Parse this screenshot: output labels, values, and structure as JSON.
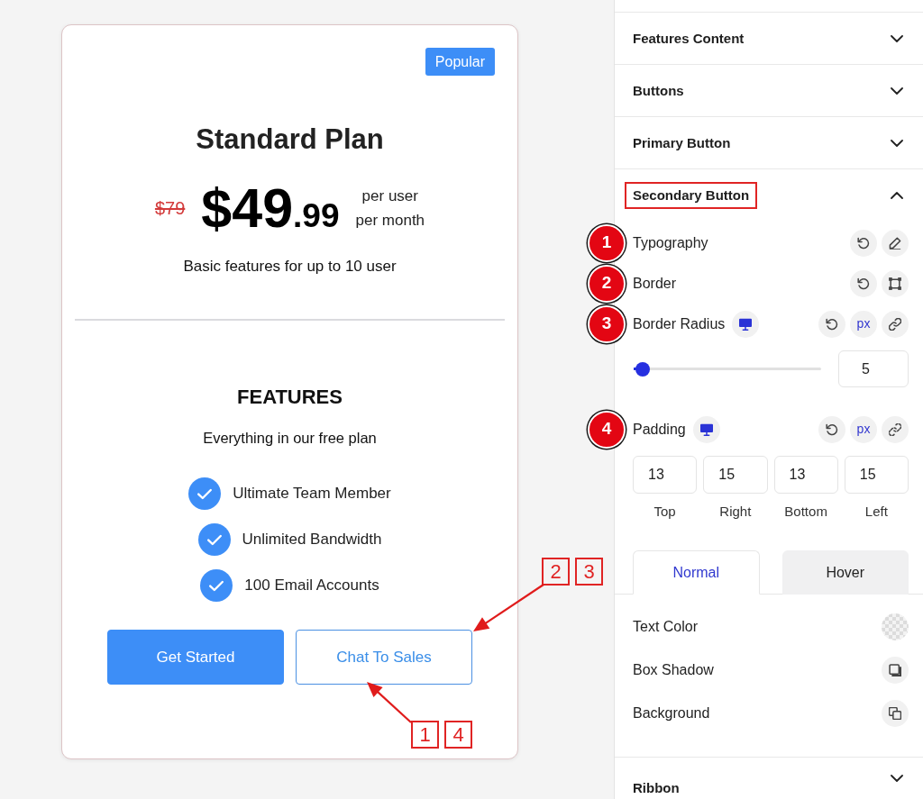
{
  "pricing_card": {
    "badge": "Popular",
    "title": "Standard Plan",
    "old_price": "$79",
    "price": {
      "amount": "$49",
      "cents": ".99"
    },
    "price_period": [
      "per user",
      "per month"
    ],
    "description": "Basic features for up to 10 user",
    "features_heading": "FEATURES",
    "features_subheading": "Everything in our free plan",
    "features": [
      "Ultimate Team Member",
      "Unlimited Bandwidth",
      "100 Email Accounts"
    ],
    "buttons": [
      {
        "label": "Get Started",
        "kind": "primary"
      },
      {
        "label": "Chat To Sales",
        "kind": "secondary"
      }
    ]
  },
  "callouts": [
    {
      "labels": [
        "2",
        "3"
      ]
    },
    {
      "labels": [
        "1",
        "4"
      ]
    }
  ],
  "settings_panel": {
    "sections": [
      {
        "title": "Features Content",
        "expanded": false,
        "highlighted": false
      },
      {
        "title": "Buttons",
        "expanded": false,
        "highlighted": false
      },
      {
        "title": "Primary Button",
        "expanded": false,
        "highlighted": false
      },
      {
        "title": "Secondary Button",
        "expanded": true,
        "highlighted": true,
        "controls": [
          {
            "kind": "typography",
            "marker": "1",
            "label": "Typography"
          },
          {
            "kind": "border",
            "marker": "2",
            "label": "Border"
          },
          {
            "kind": "slider",
            "marker": "3",
            "label": "Border Radius",
            "unit": "px",
            "level": 0.05,
            "value": "5"
          },
          {
            "kind": "dimensions",
            "marker": "4",
            "label": "Padding",
            "unit": "px",
            "fields": [
              {
                "label": "Top",
                "value": "13"
              },
              {
                "label": "Right",
                "value": "15"
              },
              {
                "label": "Bottom",
                "value": "13"
              },
              {
                "label": "Left",
                "value": "15"
              }
            ]
          }
        ],
        "tabs": [
          {
            "label": "Normal",
            "selected": true
          },
          {
            "label": "Hover",
            "selected": false
          }
        ],
        "style_options": [
          {
            "kind": "color",
            "label": "Text Color"
          },
          {
            "kind": "shadow",
            "label": "Box Shadow"
          },
          {
            "kind": "background",
            "label": "Background"
          }
        ]
      },
      {
        "title": "Ribbon",
        "expanded": false,
        "highlighted": false
      }
    ]
  }
}
